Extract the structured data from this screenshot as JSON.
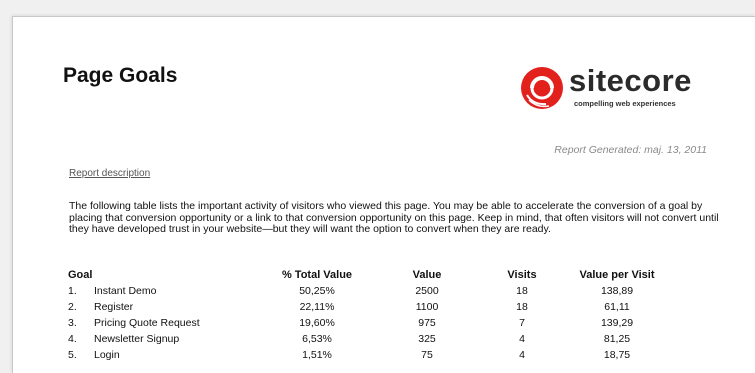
{
  "report": {
    "title": "Page Goals",
    "generated": "Report Generated: maj. 13, 2011",
    "description_link": "Report description",
    "intro": "The following table lists the important activity of visitors who viewed this page. You may be able to accelerate the conversion of a goal by placing that conversion opportunity or a link to that conversion opportunity on this page. Keep in mind, that often visitors will not convert until they have developed trust in your website—but they will want the option to convert when they are ready."
  },
  "logo": {
    "wordmark": "sitecore",
    "tagline": "compelling web experiences",
    "color": "#e3211c"
  },
  "table": {
    "headers": {
      "goal": "Goal",
      "pct": "% Total Value",
      "value": "Value",
      "visits": "Visits",
      "vpv": "Value per Visit"
    },
    "rows": [
      {
        "num": "1.",
        "goal": "Instant Demo",
        "pct": "50,25%",
        "value": "2500",
        "visits": "18",
        "vpv": "138,89"
      },
      {
        "num": "2.",
        "goal": "Register",
        "pct": "22,11%",
        "value": "1100",
        "visits": "18",
        "vpv": "61,11"
      },
      {
        "num": "3.",
        "goal": "Pricing Quote Request",
        "pct": "19,60%",
        "value": "975",
        "visits": "7",
        "vpv": "139,29"
      },
      {
        "num": "4.",
        "goal": "Newsletter Signup",
        "pct": "6,53%",
        "value": "325",
        "visits": "4",
        "vpv": "81,25"
      },
      {
        "num": "5.",
        "goal": "Login",
        "pct": "1,51%",
        "value": "75",
        "visits": "4",
        "vpv": "18,75"
      }
    ]
  }
}
